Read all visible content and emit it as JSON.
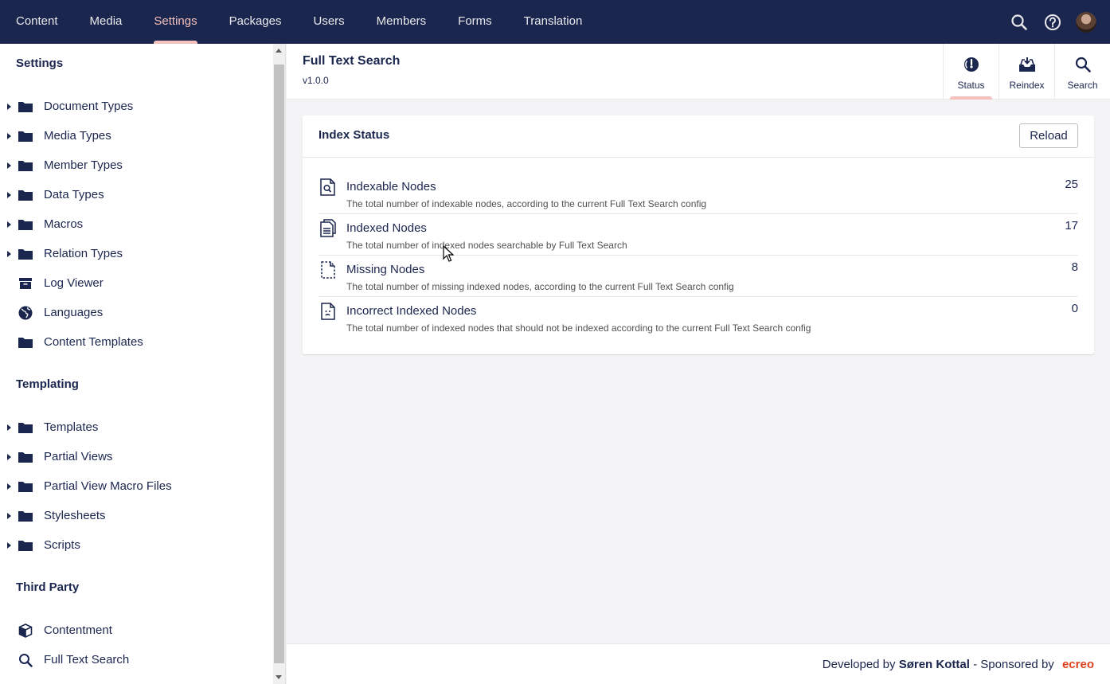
{
  "topnav": {
    "items": [
      {
        "label": "Content",
        "active": false
      },
      {
        "label": "Media",
        "active": false
      },
      {
        "label": "Settings",
        "active": true
      },
      {
        "label": "Packages",
        "active": false
      },
      {
        "label": "Users",
        "active": false
      },
      {
        "label": "Members",
        "active": false
      },
      {
        "label": "Forms",
        "active": false
      },
      {
        "label": "Translation",
        "active": false
      }
    ],
    "icons": [
      "search-icon",
      "help-icon",
      "avatar"
    ]
  },
  "sidebar": {
    "sections": [
      {
        "title": "Settings",
        "items": [
          {
            "label": "Document Types",
            "icon": "folder-icon",
            "expandable": true
          },
          {
            "label": "Media Types",
            "icon": "folder-icon",
            "expandable": true
          },
          {
            "label": "Member Types",
            "icon": "folder-icon",
            "expandable": true
          },
          {
            "label": "Data Types",
            "icon": "folder-icon",
            "expandable": true
          },
          {
            "label": "Macros",
            "icon": "folder-icon",
            "expandable": true
          },
          {
            "label": "Relation Types",
            "icon": "folder-icon",
            "expandable": true
          },
          {
            "label": "Log Viewer",
            "icon": "archive-icon",
            "expandable": false
          },
          {
            "label": "Languages",
            "icon": "globe-icon",
            "expandable": false
          },
          {
            "label": "Content Templates",
            "icon": "folder-icon",
            "expandable": false
          }
        ]
      },
      {
        "title": "Templating",
        "items": [
          {
            "label": "Templates",
            "icon": "folder-icon",
            "expandable": true
          },
          {
            "label": "Partial Views",
            "icon": "folder-icon",
            "expandable": true
          },
          {
            "label": "Partial View Macro Files",
            "icon": "folder-icon",
            "expandable": true
          },
          {
            "label": "Stylesheets",
            "icon": "folder-icon",
            "expandable": true
          },
          {
            "label": "Scripts",
            "icon": "folder-icon",
            "expandable": true
          }
        ]
      },
      {
        "title": "Third Party",
        "items": [
          {
            "label": "Contentment",
            "icon": "box-icon",
            "expandable": false
          },
          {
            "label": "Full Text Search",
            "icon": "search-icon",
            "expandable": false
          }
        ]
      }
    ]
  },
  "header": {
    "title": "Full Text Search",
    "version": "v1.0.0",
    "tabs": [
      {
        "label": "Status",
        "icon": "status-icon",
        "active": true
      },
      {
        "label": "Reindex",
        "icon": "reindex-icon",
        "active": false
      },
      {
        "label": "Search",
        "icon": "search-icon",
        "active": false
      }
    ]
  },
  "index_status": {
    "title": "Index Status",
    "reload_label": "Reload",
    "rows": [
      {
        "name": "Indexable Nodes",
        "description": "The total number of indexable nodes, according to the current Full Text Search config",
        "value": "25",
        "icon": "document-search-icon"
      },
      {
        "name": "Indexed Nodes",
        "description": "The total number of indexed nodes searchable by Full Text Search",
        "value": "17",
        "icon": "documents-icon"
      },
      {
        "name": "Missing Nodes",
        "description": "The total number of missing indexed nodes, according to the current Full Text Search config",
        "value": "8",
        "icon": "document-dashed-icon"
      },
      {
        "name": "Incorrect Indexed Nodes",
        "description": "The total number of indexed nodes that should not be indexed according to the current Full Text Search config",
        "value": "0",
        "icon": "document-sad-icon"
      }
    ]
  },
  "footer": {
    "prefix": "Developed by",
    "author": "Søren Kottal",
    "middle": "- Sponsored by",
    "sponsor": "ecreo"
  },
  "colors": {
    "nav_bg": "#1b264f",
    "accent": "#f5c1bc",
    "text": "#1b264f",
    "sponsor": "#e0411d"
  }
}
